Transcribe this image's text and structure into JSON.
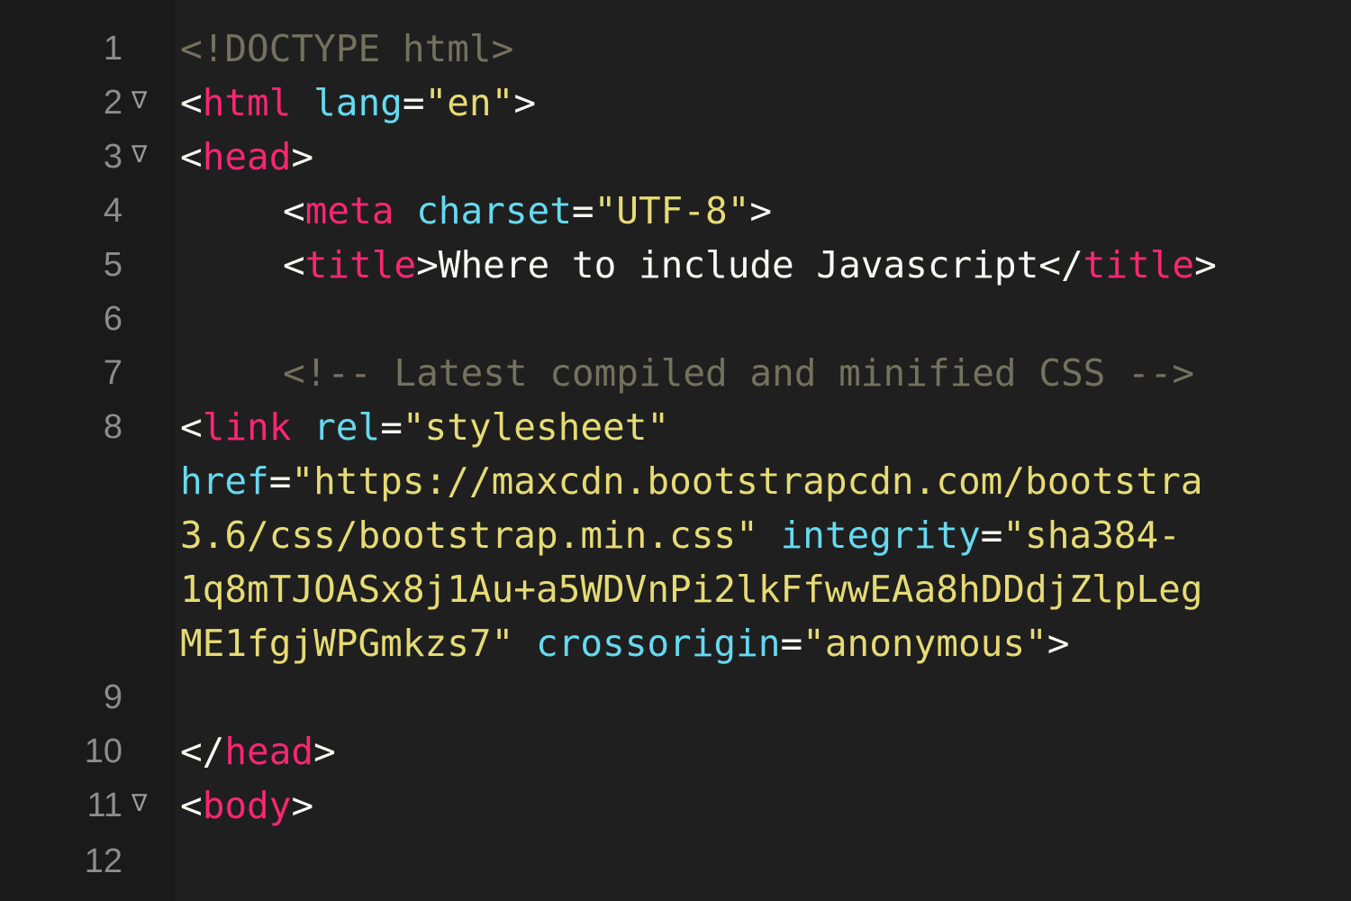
{
  "editor": {
    "lines": [
      {
        "num": "1",
        "fold": "",
        "parts": [
          {
            "text": "<!DOCTYPE html>",
            "kind": "cmt"
          }
        ]
      },
      {
        "num": "2",
        "fold": "∇",
        "parts": [
          {
            "text": "<",
            "kind": "punct"
          },
          {
            "text": "html",
            "kind": "tag"
          },
          {
            "text": " ",
            "kind": "punct"
          },
          {
            "text": "lang",
            "kind": "attr"
          },
          {
            "text": "=",
            "kind": "punct"
          },
          {
            "text": "\"en\"",
            "kind": "str"
          },
          {
            "text": ">",
            "kind": "punct"
          }
        ]
      },
      {
        "num": "3",
        "fold": "∇",
        "parts": [
          {
            "text": "<",
            "kind": "punct"
          },
          {
            "text": "head",
            "kind": "tag"
          },
          {
            "text": ">",
            "kind": "punct"
          }
        ]
      },
      {
        "num": "4",
        "fold": "",
        "parts": [
          {
            "text": "<",
            "kind": "punct"
          },
          {
            "text": "meta",
            "kind": "tag"
          },
          {
            "text": " ",
            "kind": "punct"
          },
          {
            "text": "charset",
            "kind": "attr"
          },
          {
            "text": "=",
            "kind": "punct"
          },
          {
            "text": "\"UTF-8\"",
            "kind": "str"
          },
          {
            "text": ">",
            "kind": "punct"
          }
        ]
      },
      {
        "num": "5",
        "fold": "",
        "parts": [
          {
            "text": "<",
            "kind": "punct"
          },
          {
            "text": "title",
            "kind": "tag"
          },
          {
            "text": ">",
            "kind": "punct"
          },
          {
            "text": "Where to include Javascript",
            "kind": "txt"
          },
          {
            "text": "</",
            "kind": "punct"
          },
          {
            "text": "title",
            "kind": "tag"
          },
          {
            "text": ">",
            "kind": "punct"
          }
        ]
      },
      {
        "num": "6",
        "fold": "",
        "parts": []
      },
      {
        "num": "7",
        "fold": "",
        "parts": [
          {
            "text": "<!-- Latest compiled and minified CSS -->",
            "kind": "cmt"
          }
        ]
      },
      {
        "num": "8",
        "fold": "",
        "parts": [
          {
            "text": "<",
            "kind": "punct"
          },
          {
            "text": "link",
            "kind": "tag"
          },
          {
            "text": " ",
            "kind": "punct"
          },
          {
            "text": "rel",
            "kind": "attr"
          },
          {
            "text": "=",
            "kind": "punct"
          },
          {
            "text": "\"stylesheet\"",
            "kind": "str"
          }
        ]
      },
      {
        "num": "",
        "fold": "",
        "parts": [
          {
            "text": "href",
            "kind": "attr"
          },
          {
            "text": "=",
            "kind": "punct"
          },
          {
            "text": "\"https://maxcdn.bootstrapcdn.com/bootstra",
            "kind": "str"
          }
        ]
      },
      {
        "num": "",
        "fold": "",
        "parts": [
          {
            "text": "3.6/css/bootstrap.min.css\"",
            "kind": "str"
          },
          {
            "text": " ",
            "kind": "punct"
          },
          {
            "text": "integrity",
            "kind": "attr"
          },
          {
            "text": "=",
            "kind": "punct"
          },
          {
            "text": "\"sha384-",
            "kind": "str"
          }
        ]
      },
      {
        "num": "",
        "fold": "",
        "parts": [
          {
            "text": "1q8mTJOASx8j1Au+a5WDVnPi2lkFfwwEAa8hDDdjZlpLeg",
            "kind": "str"
          }
        ]
      },
      {
        "num": "",
        "fold": "",
        "parts": [
          {
            "text": "ME1fgjWPGmkzs7\"",
            "kind": "str"
          },
          {
            "text": " ",
            "kind": "punct"
          },
          {
            "text": "crossorigin",
            "kind": "attr"
          },
          {
            "text": "=",
            "kind": "punct"
          },
          {
            "text": "\"anonymous\"",
            "kind": "str"
          },
          {
            "text": ">",
            "kind": "punct"
          }
        ]
      },
      {
        "num": "9",
        "fold": "",
        "parts": []
      },
      {
        "num": "10",
        "fold": "",
        "parts": [
          {
            "text": "</",
            "kind": "punct"
          },
          {
            "text": "head",
            "kind": "tag"
          },
          {
            "text": ">",
            "kind": "punct"
          }
        ]
      },
      {
        "num": "11",
        "fold": "∇",
        "parts": [
          {
            "text": "<",
            "kind": "punct"
          },
          {
            "text": "body",
            "kind": "tag"
          },
          {
            "text": ">",
            "kind": "punct"
          }
        ]
      },
      {
        "num": "12",
        "fold": "",
        "parts": []
      }
    ]
  }
}
